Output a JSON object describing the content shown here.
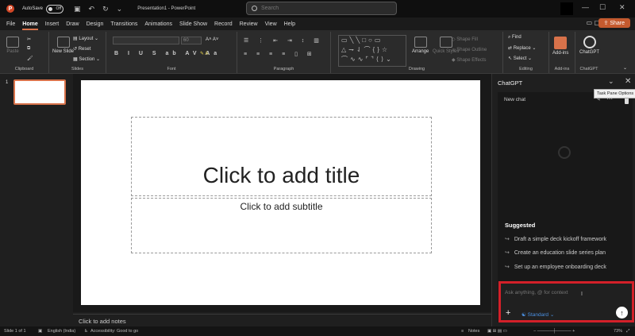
{
  "titlebar": {
    "autosave_label": "AutoSave",
    "autosave_state": "Off",
    "doc_title": "Presentation1 - PowerPoint",
    "search_placeholder": "Search"
  },
  "tabs": [
    "File",
    "Home",
    "Insert",
    "Draw",
    "Design",
    "Transitions",
    "Animations",
    "Slide Show",
    "Record",
    "Review",
    "View",
    "Help"
  ],
  "active_tab": "Home",
  "share_label": "Share",
  "ribbon": {
    "clipboard": {
      "label": "Clipboard",
      "paste": "Paste"
    },
    "slides": {
      "label": "Slides",
      "new_slide": "New\nSlide",
      "layout": "Layout",
      "reset": "Reset",
      "section": "Section"
    },
    "font": {
      "label": "Font",
      "size": "60"
    },
    "paragraph": {
      "label": "Paragraph"
    },
    "drawing": {
      "label": "Drawing",
      "arrange": "Arrange",
      "quick_styles": "Quick Styles",
      "shape_fill": "Shape Fill",
      "shape_outline": "Shape Outline",
      "shape_effects": "Shape Effects"
    },
    "editing": {
      "label": "Editing",
      "find": "Find",
      "replace": "Replace",
      "select": "Select"
    },
    "addins": {
      "label": "Add-ins",
      "button": "Add-ins"
    },
    "chatgpt": {
      "label": "ChatGPT",
      "button": "ChatGPT"
    }
  },
  "thumbnails": [
    {
      "number": "1"
    }
  ],
  "slide": {
    "title_placeholder": "Click to add title",
    "subtitle_placeholder": "Click to add subtitle"
  },
  "notes_placeholder": "Click to add notes",
  "statusbar": {
    "slide_info": "Slide 1 of 1",
    "language": "English (India)",
    "accessibility": "Accessibility: Good to go",
    "notes": "Notes",
    "zoom": "73%"
  },
  "chat_pane": {
    "title": "ChatGPT",
    "tooltip": "Task Pane Options",
    "new_chat": "New chat",
    "suggested_title": "Suggested",
    "suggestions": [
      "Draft a simple deck kickoff framework",
      "Create an education slide series plan",
      "Set up an employee onboarding deck"
    ],
    "input_placeholder": "Ask anything, @ for context",
    "mode": "Standard",
    "highlight_color": "#d32029"
  }
}
